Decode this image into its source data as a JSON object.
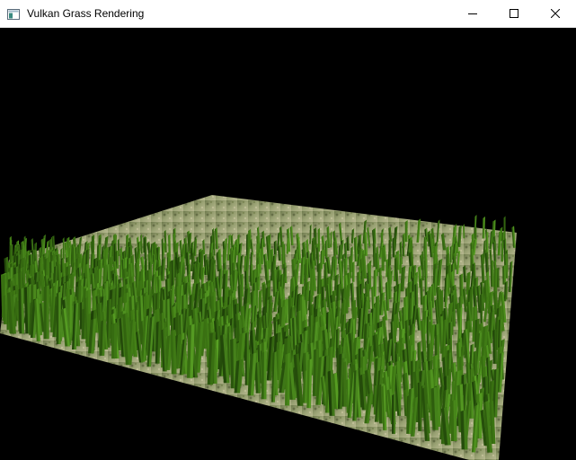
{
  "window": {
    "title": "Vulkan Grass Rendering",
    "icon": "app-window-icon",
    "controls": {
      "minimize_icon": "minimize-icon",
      "maximize_icon": "maximize-icon",
      "close_icon": "close-icon"
    }
  },
  "scene": {
    "background": "#000000",
    "ground_color": "#8f9a6a",
    "grass_dark": "#1d3f08",
    "grass_mid": "#3f7a14",
    "grass_light": "#7bd43a"
  }
}
